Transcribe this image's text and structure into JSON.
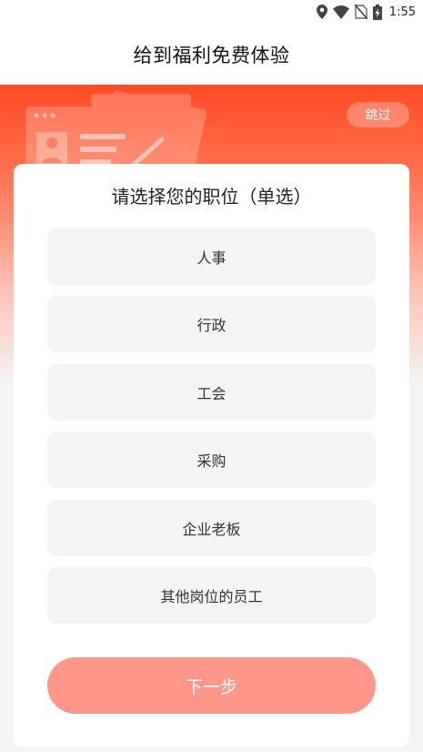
{
  "status_bar": {
    "time": "1:55",
    "icons": [
      "location-icon",
      "wifi-icon",
      "no-sim-icon",
      "battery-charging-icon"
    ]
  },
  "header": {
    "title": "给到福利免费体验"
  },
  "banner": {
    "skip_label": "跳过",
    "illustration": "resume-document-icon"
  },
  "card": {
    "title": "请选择您的职位（单选）",
    "options": [
      {
        "label": "人事"
      },
      {
        "label": "行政"
      },
      {
        "label": "工会"
      },
      {
        "label": "采购"
      },
      {
        "label": "企业老板"
      },
      {
        "label": "其他岗位的员工"
      }
    ],
    "next_label": "下一步"
  },
  "colors": {
    "accent": "#ff4a26",
    "button_disabled": "#fe978a",
    "option_bg": "#f4f4f4"
  }
}
